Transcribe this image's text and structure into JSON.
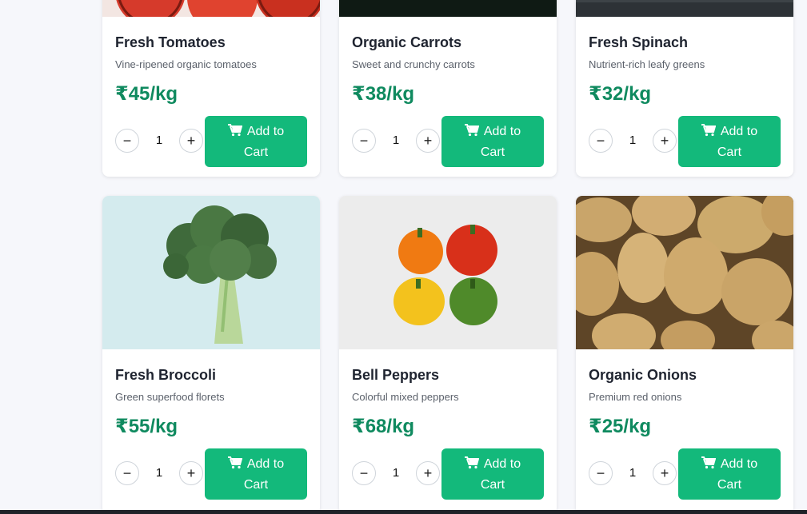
{
  "products": [
    {
      "name": "Fresh Tomatoes",
      "description": "Vine-ripened organic tomatoes",
      "price": "₹45/kg",
      "quantity": "1",
      "image_icon": "tomatoes-image",
      "add_label_1": "Add to",
      "add_label_2": "Cart"
    },
    {
      "name": "Organic Carrots",
      "description": "Sweet and crunchy carrots",
      "price": "₹38/kg",
      "quantity": "1",
      "image_icon": "carrots-image",
      "add_label_1": "Add to",
      "add_label_2": "Cart"
    },
    {
      "name": "Fresh Spinach",
      "description": "Nutrient-rich leafy greens",
      "price": "₹32/kg",
      "quantity": "1",
      "image_icon": "spinach-image",
      "add_label_1": "Add to",
      "add_label_2": "Cart"
    },
    {
      "name": "Fresh Broccoli",
      "description": "Green superfood florets",
      "price": "₹55/kg",
      "quantity": "1",
      "image_icon": "broccoli-image",
      "add_label_1": "Add to",
      "add_label_2": "Cart"
    },
    {
      "name": "Bell Peppers",
      "description": "Colorful mixed peppers",
      "price": "₹68/kg",
      "quantity": "1",
      "image_icon": "bell-peppers-image",
      "add_label_1": "Add to",
      "add_label_2": "Cart"
    },
    {
      "name": "Organic Onions",
      "description": "Premium red onions",
      "price": "₹25/kg",
      "quantity": "1",
      "image_icon": "potatoes-image",
      "add_label_1": "Add to",
      "add_label_2": "Cart"
    }
  ],
  "icons": {
    "minus": "−",
    "plus": "+",
    "cart": "cart-icon"
  },
  "colors": {
    "accent": "#13b97b",
    "price": "#0f8a5f",
    "page_bg": "#f6f7fb"
  }
}
